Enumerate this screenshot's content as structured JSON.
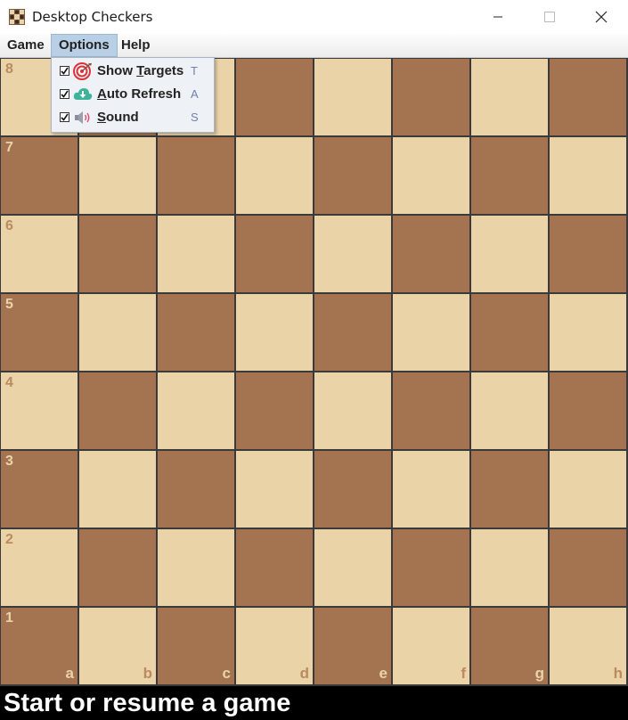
{
  "window": {
    "title": "Desktop Checkers",
    "icon": "checkers-board-icon",
    "controls": [
      "minimize",
      "maximize",
      "close"
    ]
  },
  "menubar": {
    "items": [
      {
        "label": "Game"
      },
      {
        "label": "Options",
        "state": "open"
      },
      {
        "label": "Help"
      }
    ]
  },
  "options_menu": {
    "items": [
      {
        "label_pre": "Show ",
        "label_mnemonic": "T",
        "label_post": "argets",
        "shortcut": "T",
        "checked": true,
        "icon": "target-icon"
      },
      {
        "label_pre": "",
        "label_mnemonic": "A",
        "label_post": "uto Refresh",
        "shortcut": "A",
        "checked": true,
        "icon": "cloud-download-icon"
      },
      {
        "label_pre": "",
        "label_mnemonic": "S",
        "label_post": "ound",
        "shortcut": "S",
        "checked": true,
        "icon": "speaker-icon"
      }
    ]
  },
  "board": {
    "ranks": [
      "8",
      "7",
      "6",
      "5",
      "4",
      "3",
      "2",
      "1"
    ],
    "files": [
      "a",
      "b",
      "c",
      "d",
      "e",
      "f",
      "g",
      "h"
    ],
    "colors": {
      "light": "#ebd3a8",
      "dark": "#a47451",
      "grid": "#3a3a3a"
    }
  },
  "status": {
    "text": "Start or resume a game"
  }
}
